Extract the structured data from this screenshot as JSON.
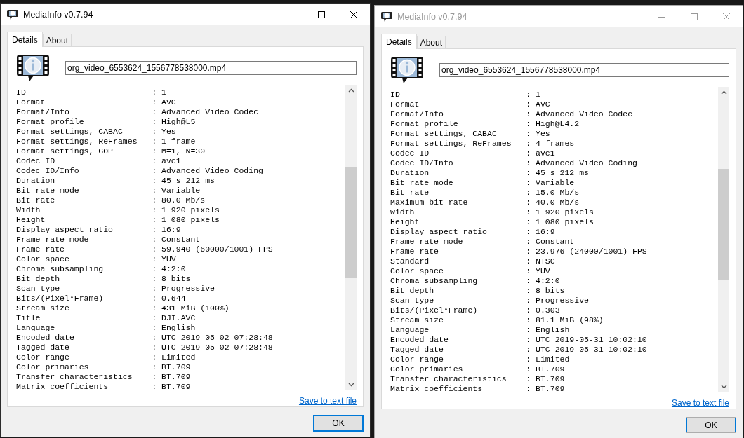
{
  "windows": [
    {
      "title": "MediaInfo v0.7.94",
      "active": true,
      "tabs": [
        {
          "label": "Details",
          "selected": true
        },
        {
          "label": "About",
          "selected": false
        }
      ],
      "file_field": {
        "value": "org_video_6553624_1556778538000.mp4"
      },
      "lines": [
        "ID                          : 1",
        "Format                      : AVC",
        "Format/Info                 : Advanced Video Codec",
        "Format profile              : High@L5",
        "Format settings, CABAC      : Yes",
        "Format settings, ReFrames   : 1 frame",
        "Format settings, GOP        : M=1, N=30",
        "Codec ID                    : avc1",
        "Codec ID/Info               : Advanced Video Coding",
        "Duration                    : 45 s 212 ms",
        "Bit rate mode               : Variable",
        "Bit rate                    : 80.0 Mb/s",
        "Width                       : 1 920 pixels",
        "Height                      : 1 080 pixels",
        "Display aspect ratio        : 16:9",
        "Frame rate mode             : Constant",
        "Frame rate                  : 59.940 (60000/1001) FPS",
        "Color space                 : YUV",
        "Chroma subsampling          : 4:2:0",
        "Bit depth                   : 8 bits",
        "Scan type                   : Progressive",
        "Bits/(Pixel*Frame)          : 0.644",
        "Stream size                 : 431 MiB (100%)",
        "Title                       : DJI.AVC",
        "Language                    : English",
        "Encoded date                : UTC 2019-05-02 07:28:48",
        "Tagged date                 : UTC 2019-05-02 07:28:48",
        "Color range                 : Limited",
        "Color primaries             : BT.709",
        "Transfer characteristics    : BT.709",
        "Matrix coefficients         : BT.709"
      ],
      "save_link": "Save to text file",
      "ok_button": "OK"
    },
    {
      "title": "MediaInfo v0.7.94",
      "active": false,
      "tabs": [
        {
          "label": "Details",
          "selected": true
        },
        {
          "label": "About",
          "selected": false
        }
      ],
      "file_field": {
        "value": "org_video_6553624_1556778538000.mp4"
      },
      "lines": [
        "ID                          : 1",
        "Format                      : AVC",
        "Format/Info                 : Advanced Video Codec",
        "Format profile              : High@L4.2",
        "Format settings, CABAC      : Yes",
        "Format settings, ReFrames   : 4 frames",
        "Codec ID                    : avc1",
        "Codec ID/Info               : Advanced Video Coding",
        "Duration                    : 45 s 212 ms",
        "Bit rate mode               : Variable",
        "Bit rate                    : 15.0 Mb/s",
        "Maximum bit rate            : 40.0 Mb/s",
        "Width                       : 1 920 pixels",
        "Height                      : 1 080 pixels",
        "Display aspect ratio        : 16:9",
        "Frame rate mode             : Constant",
        "Frame rate                  : 23.976 (24000/1001) FPS",
        "Standard                    : NTSC",
        "Color space                 : YUV",
        "Chroma subsampling          : 4:2:0",
        "Bit depth                   : 8 bits",
        "Scan type                   : Progressive",
        "Bits/(Pixel*Frame)          : 0.303",
        "Stream size                 : 81.1 MiB (98%)",
        "Language                    : English",
        "Encoded date                : UTC 2019-05-31 10:02:10",
        "Tagged date                 : UTC 2019-05-31 10:02:10",
        "Color range                 : Limited",
        "Color primaries             : BT.709",
        "Transfer characteristics    : BT.709",
        "Matrix coefficients         : BT.709"
      ],
      "save_link": "Save to text file",
      "ok_button": "OK"
    }
  ]
}
